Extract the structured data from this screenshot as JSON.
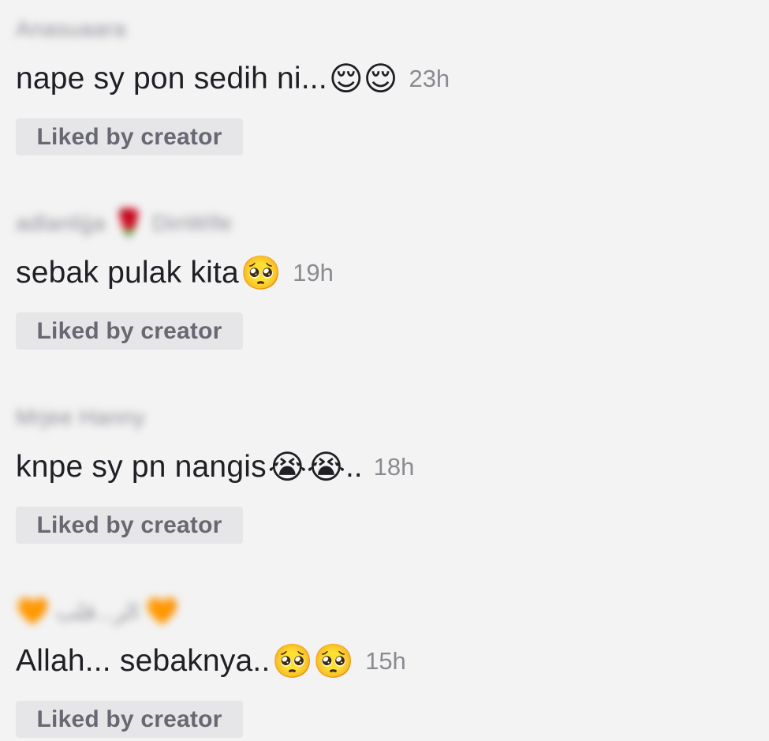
{
  "comments": [
    {
      "username": "Anasuaara",
      "text": "nape sy pon sedih ni...",
      "emojis": "😌😌",
      "suffix": "",
      "time": "23h",
      "badge": "Liked by creator"
    },
    {
      "username_before": "adlanlijja",
      "username_emoji": "🌹",
      "username_after": "DinWife",
      "text": "sebak pulak kita",
      "emojis": "🥺",
      "suffix": "",
      "time": "19h",
      "badge": "Liked by creator"
    },
    {
      "username": "Mrjee Hanny",
      "text": "knpe sy pn nangis",
      "emojis": "😭😭",
      "suffix": "..",
      "time": "18h",
      "badge": "Liked by creator"
    },
    {
      "username_left_emoji": "🧡",
      "username": "ﺍﻟﺮ...ﻗﻠﺐ",
      "username_right_emoji": "🧡",
      "text": "Allah... sebaknya.. ",
      "emojis": "🥺🥺",
      "suffix": "",
      "time": "15h",
      "badge": "Liked by creator"
    }
  ]
}
